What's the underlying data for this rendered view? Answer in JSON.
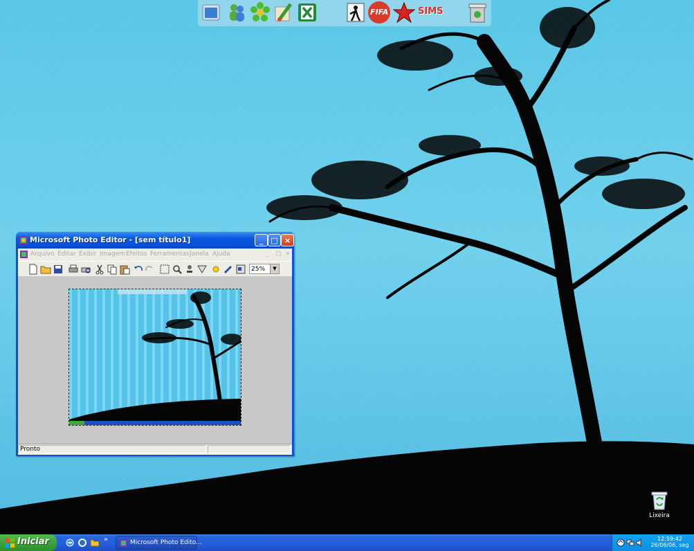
{
  "dock": {
    "icons": [
      "window-icon",
      "messenger-icon",
      "icq-flower-icon",
      "brush-icon",
      "excel-icon",
      "counter-strike-icon",
      "fifa-icon",
      "red-star-icon",
      "sims-icon",
      "trash-icon"
    ],
    "labels": {
      "fifa": "FIFA",
      "sims": "SIMS"
    }
  },
  "window": {
    "title": "Microsoft Photo Editor - [sem título1]",
    "menu": [
      "Arquivo",
      "Editar",
      "Exibir",
      "Imagem",
      "Efeitos",
      "Ferramentas",
      "Janela",
      "Ajuda"
    ],
    "zoom": "25%",
    "status": "Pronto",
    "controls": {
      "minimize": "_",
      "maximize": "□",
      "close": "×"
    }
  },
  "desktop": {
    "recycle_bin": "Lixeira"
  },
  "taskbar": {
    "start": "Iniciar",
    "more": "»",
    "task": "Microsoft Photo Edito...",
    "clock_time": "12:59:42",
    "clock_date": "26/06/06, seg"
  }
}
